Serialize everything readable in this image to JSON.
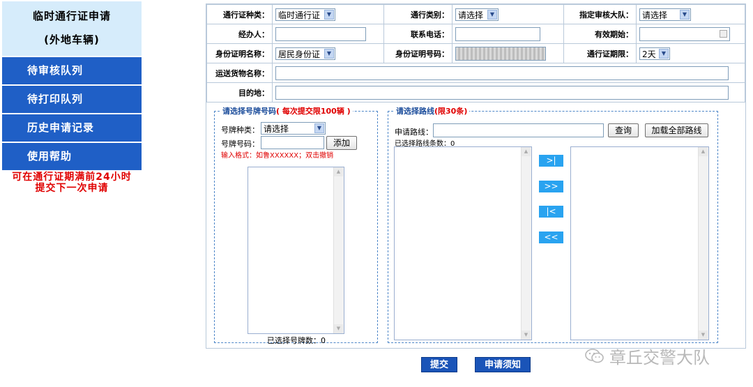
{
  "sidebar": {
    "title_line1": "临时通行证申请",
    "title_line2": "(外地车辆)",
    "items": [
      {
        "label": "待审核队列"
      },
      {
        "label": "待打印队列"
      },
      {
        "label": "历史申请记录"
      },
      {
        "label": "使用帮助"
      }
    ],
    "note_line1": "可在通行证期满前24小时",
    "note_line2": "提交下一次申请"
  },
  "form": {
    "permit_type_label": "通行证种类：",
    "permit_type_value": "临时通行证",
    "pass_category_label": "通行类别：",
    "pass_category_value": "请选择",
    "review_brigade_label": "指定审核大队：",
    "review_brigade_value": "请选择",
    "handler_label": "经办人：",
    "handler_value": "",
    "phone_label": "联系电话：",
    "phone_value": "",
    "valid_start_label": "有效期始：",
    "valid_start_value": "",
    "id_type_label": "身份证明名称：",
    "id_type_value": "居民身份证",
    "id_number_label": "身份证明号码：",
    "permit_period_label": "通行证期限：",
    "permit_period_value": "2天",
    "cargo_label": "运送货物名称：",
    "cargo_value": "",
    "destination_label": "目的地：",
    "destination_value": ""
  },
  "plates": {
    "legend": "请选择号牌号码",
    "legend_note": "( 每次提交限100辆 )",
    "plate_type_label": "号牌种类：",
    "plate_type_value": "请选择",
    "plate_number_label": "号牌号码：",
    "plate_number_value": "",
    "add_button": "添加",
    "hint": "输入格式：如鲁XXXXXX；双击撤销",
    "selected_count": "已选择号牌数：0"
  },
  "routes": {
    "legend": "请选择路线",
    "legend_open": "(",
    "legend_limit": "限30条",
    "legend_close": ")",
    "apply_route_label": "申请路线：",
    "apply_route_value": "",
    "query_button": "查询",
    "load_all_button": "加载全部路线",
    "selected_count": "已选择路线条数：0",
    "move_buttons": [
      ">|",
      ">>",
      "|<",
      "<<"
    ]
  },
  "actions": {
    "submit": "提交",
    "notice": "申请须知"
  },
  "watermark": "章丘交警大队",
  "colors": {
    "sidebar_header_bg": "#d6ecfb",
    "sidebar_item_bg": "#1f5fc6",
    "note_red": "#e00000",
    "legend_blue": "#1d4e9c",
    "move_button": "#29a3f0",
    "action_button": "#1a54b8"
  }
}
